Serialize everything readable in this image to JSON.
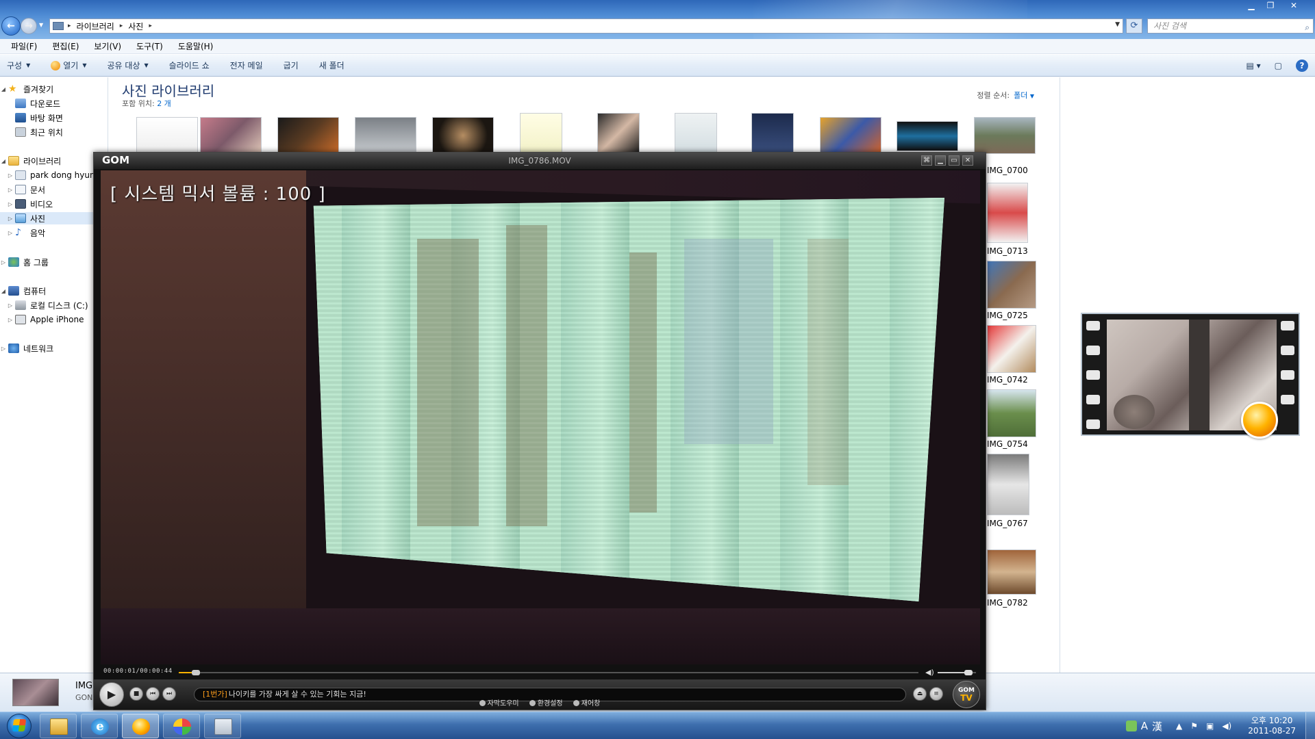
{
  "explorer": {
    "breadcrumb": [
      "라이브러리",
      "사진"
    ],
    "search_placeholder": "사진 검색",
    "menu": [
      "파일(F)",
      "편집(E)",
      "보기(V)",
      "도구(T)",
      "도움말(H)"
    ],
    "commands": [
      "구성",
      "열기",
      "공유 대상",
      "슬라이드 쇼",
      "전자 메일",
      "굽기",
      "새 폴더"
    ],
    "nav": {
      "favorites": "즐겨찾기",
      "downloads": "다운로드",
      "desktop": "바탕 화면",
      "recent": "최근 위치",
      "libraries": "라이브러리",
      "user_lib": "park dong hyun",
      "documents": "문서",
      "videos": "비디오",
      "pictures": "사진",
      "music": "음악",
      "homegroup": "홈 그룹",
      "computer": "컴퓨터",
      "local_disk": "로컬 디스크 (C:)",
      "iphone": "Apple iPhone",
      "network": "네트워크"
    },
    "library": {
      "title": "사진 라이브러리",
      "includes_label": "포함 위치:",
      "includes_link": "2 개",
      "sort_label": "정렬 순서:",
      "sort_value": "폴더"
    },
    "right_thumbs": [
      "IMG_0700",
      "IMG_0713",
      "IMG_0725",
      "IMG_0742",
      "IMG_0754",
      "IMG_0767",
      "IMG_0782"
    ],
    "details": {
      "name": "IMG",
      "type": "GON"
    }
  },
  "gom": {
    "logo": "GOM",
    "filename": "IMG_0786.MOV",
    "osd": "[ 시스템 믹서 볼륨 : 100 ]",
    "time": "00:00:01/00:00:44",
    "progress_fraction": 0.023,
    "volume_fraction": 0.8,
    "ticker_tag": "[1번가]",
    "ticker_text": "나이키를 가장 싸게 살 수 있는 기회는 지금!",
    "sublinks": [
      "자막도우미",
      "환경설정",
      "재어창"
    ],
    "tv_logo_top": "GOM",
    "tv_logo_bottom": "TV"
  },
  "taskbar": {
    "ime_mode": "A",
    "ime_hanja": "漢",
    "time": "오후 10:20",
    "date": "2011-08-27"
  },
  "colors": {
    "accent_gom": "#ffb300",
    "titlebar": "#4d8ad3",
    "library_title": "#1e3a6e",
    "link": "#0066cc"
  }
}
